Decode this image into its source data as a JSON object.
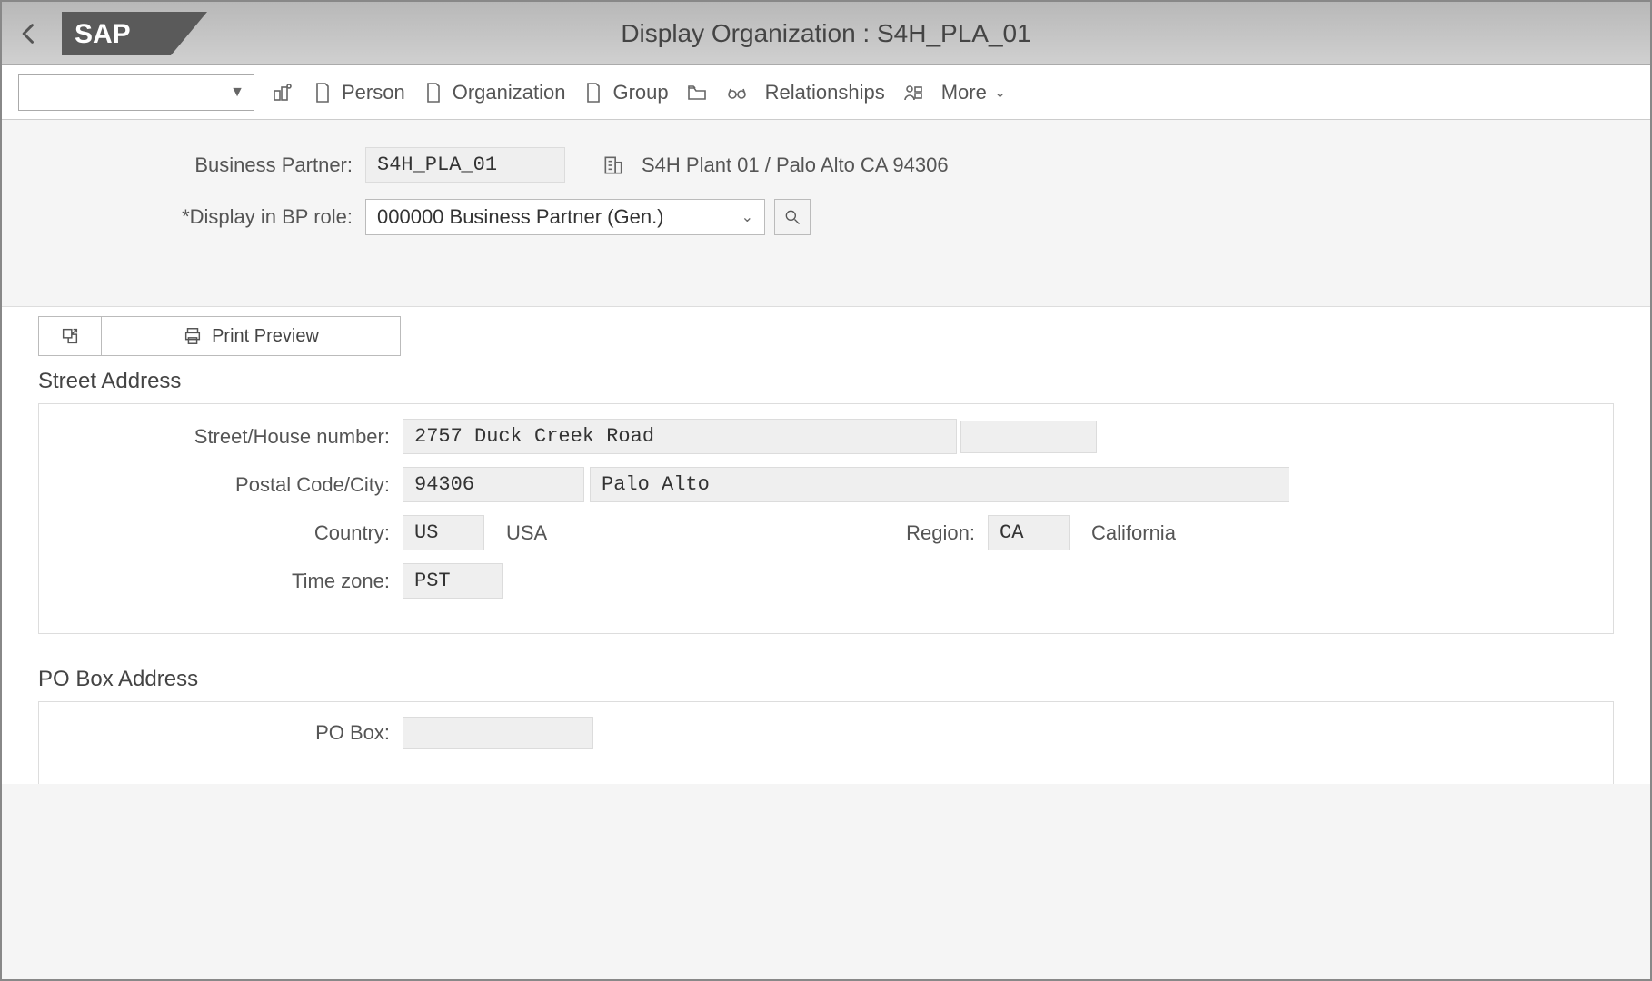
{
  "titlebar": {
    "title": "Display Organization : S4H_PLA_01"
  },
  "toolbar": {
    "person": "Person",
    "organization": "Organization",
    "group": "Group",
    "relationships": "Relationships",
    "more": "More"
  },
  "header": {
    "bp_label": "Business Partner:",
    "bp_value": "S4H_PLA_01",
    "bp_desc": "S4H Plant 01 / Palo Alto CA 94306",
    "role_label": "Display in BP role:",
    "role_value": "000000 Business Partner (Gen.)"
  },
  "actions": {
    "print_preview": "Print Preview"
  },
  "street_section": {
    "title": "Street Address",
    "street_label": "Street/House number:",
    "street_value": "2757 Duck Creek Road",
    "house_value": "",
    "postal_label": "Postal Code/City:",
    "postal_value": "94306",
    "city_value": "Palo Alto",
    "country_label": "Country:",
    "country_code": "US",
    "country_name": "USA",
    "region_label": "Region:",
    "region_code": "CA",
    "region_name": "California",
    "tz_label": "Time zone:",
    "tz_value": "PST"
  },
  "pobox_section": {
    "title": "PO Box Address",
    "pobox_label": "PO Box:",
    "pobox_value": ""
  }
}
